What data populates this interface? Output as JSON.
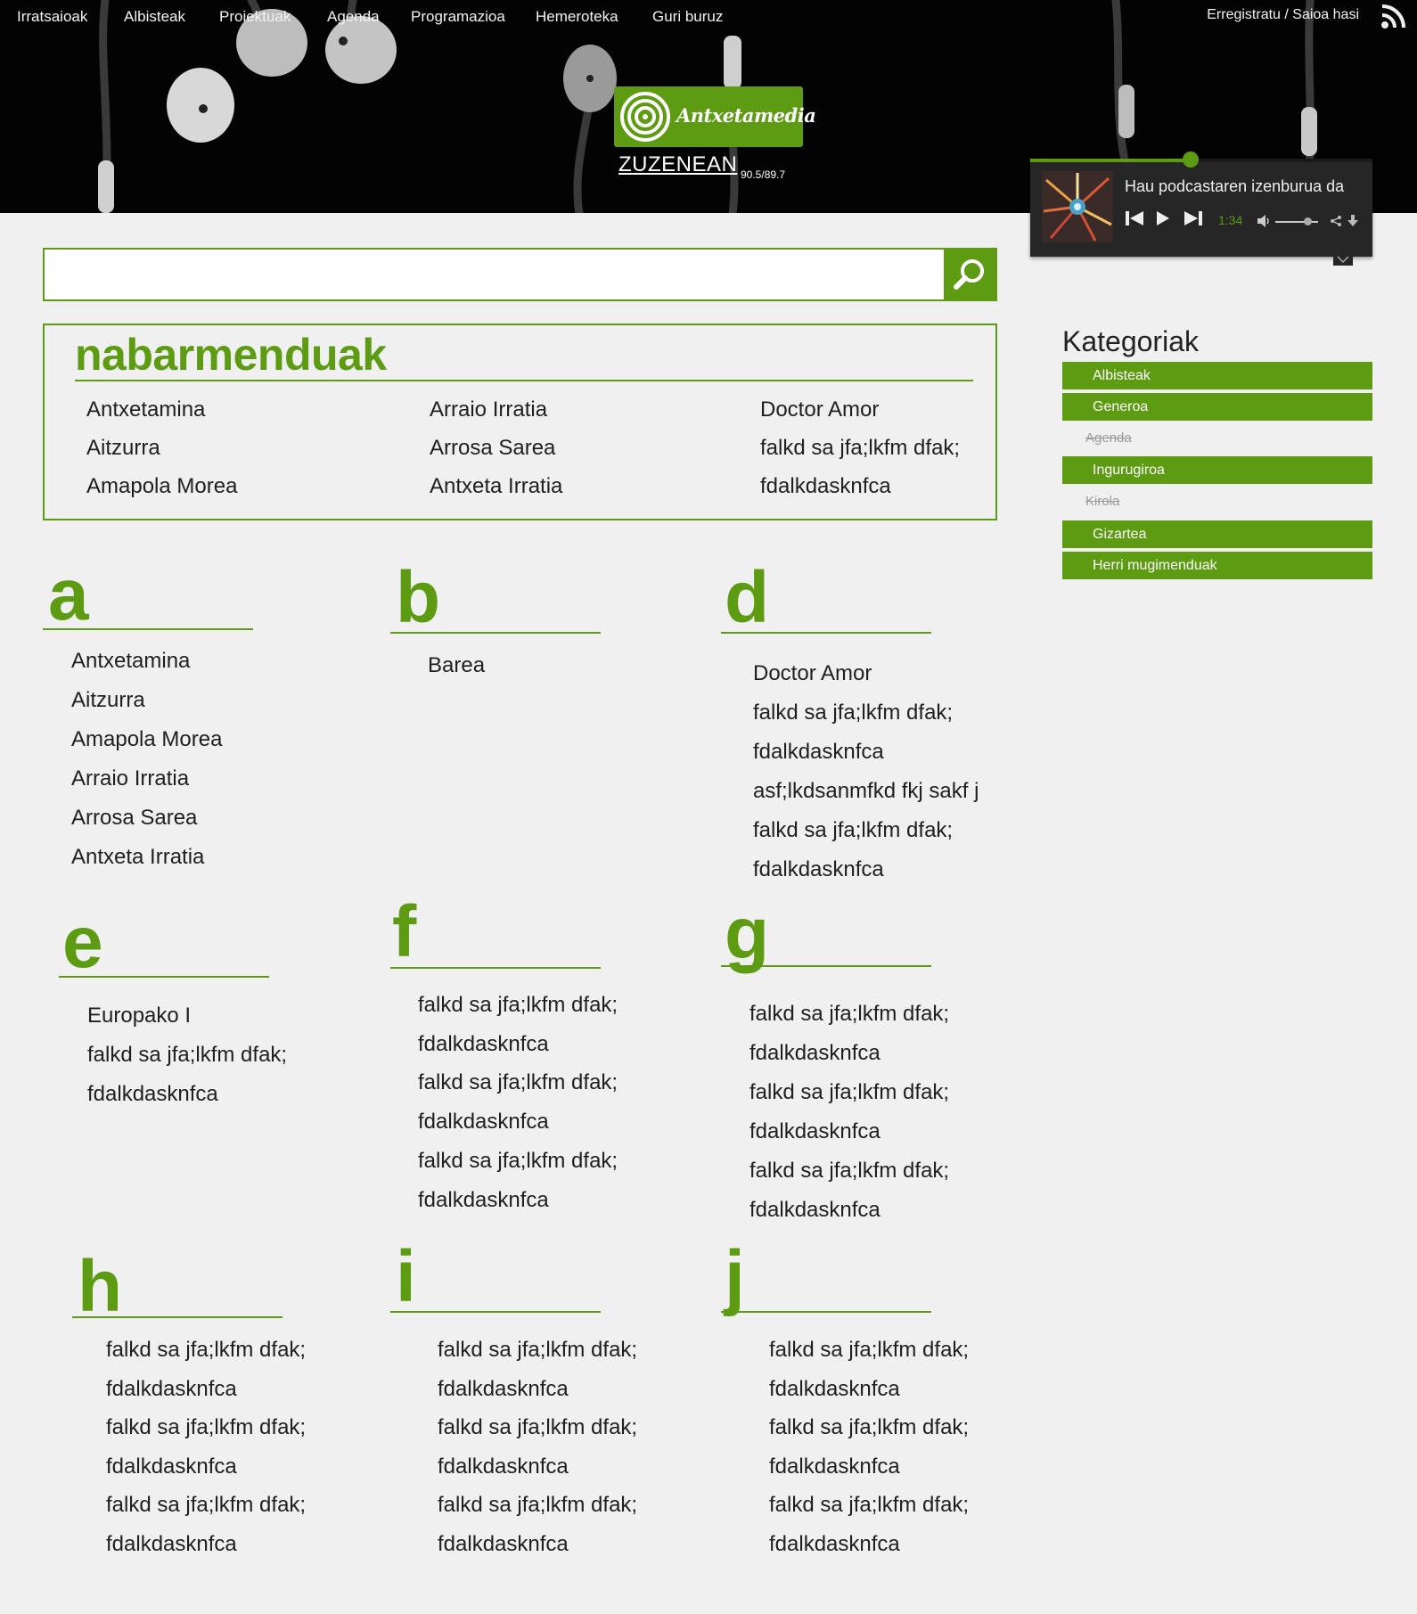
{
  "nav": {
    "items": [
      "Irratsaioak",
      "Albisteak",
      "Proiektuak",
      "Agenda",
      "Programazioa",
      "Hemeroteka",
      "Guri buruz"
    ],
    "login": "Erregistratu / Saioa hasi"
  },
  "logo": {
    "name": "Antxetamedia",
    "live_label": "ZUZENEAN",
    "frequency": "90.5/89.7"
  },
  "player": {
    "title": "Hau podcastaren izenburua da",
    "time": "1:34",
    "progress": 0.47,
    "volume": 0.75
  },
  "search": {
    "value": "",
    "placeholder": ""
  },
  "featured": {
    "title": "nabarmenduak",
    "columns": [
      [
        "Antxetamina",
        "Aitzurra",
        "Amapola Morea"
      ],
      [
        "Arraio Irratia",
        "Arrosa Sarea",
        "Antxeta Irratia"
      ],
      [
        "Doctor Amor",
        "falkd sa jfa;lkfm   dfak;",
        "fdalkdasknfca"
      ]
    ]
  },
  "groups": [
    {
      "letter": "a",
      "items": [
        "Antxetamina",
        "Aitzurra",
        "Amapola Morea",
        "Arraio Irratia",
        "Arrosa Sarea",
        "Antxeta Irratia"
      ]
    },
    {
      "letter": "b",
      "items": [
        "Barea"
      ]
    },
    {
      "letter": "d",
      "items": [
        "Doctor Amor",
        "falkd sa jfa;lkfm   dfak;",
        "fdalkdasknfca",
        "asf;lkdsanmfkd fkj sakf   j",
        "falkd sa jfa;lkfm   dfak;",
        "fdalkdasknfca"
      ]
    },
    {
      "letter": "e",
      "items": [
        "Europako I",
        "falkd sa jfa;lkfm   dfak;",
        "fdalkdasknfca"
      ]
    },
    {
      "letter": "f",
      "items": [
        "falkd sa jfa;lkfm   dfak;",
        "fdalkdasknfca",
        "falkd sa jfa;lkfm   dfak;",
        "fdalkdasknfca",
        "falkd sa jfa;lkfm   dfak;",
        "fdalkdasknfca"
      ]
    },
    {
      "letter": "g",
      "items": [
        "falkd sa jfa;lkfm   dfak;",
        "fdalkdasknfca",
        "falkd sa jfa;lkfm   dfak;",
        "fdalkdasknfca",
        "falkd sa jfa;lkfm   dfak;",
        "fdalkdasknfca"
      ]
    },
    {
      "letter": "h",
      "items": [
        "falkd sa jfa;lkfm   dfak;",
        "fdalkdasknfca",
        "falkd sa jfa;lkfm   dfak;",
        "fdalkdasknfca",
        "falkd sa jfa;lkfm   dfak;",
        "fdalkdasknfca"
      ]
    },
    {
      "letter": "i",
      "items": [
        "falkd sa jfa;lkfm   dfak;",
        "fdalkdasknfca",
        "falkd sa jfa;lkfm   dfak;",
        "fdalkdasknfca",
        "falkd sa jfa;lkfm   dfak;",
        "fdalkdasknfca"
      ]
    },
    {
      "letter": "j",
      "items": [
        "falkd sa jfa;lkfm   dfak;",
        "fdalkdasknfca",
        "falkd sa jfa;lkfm   dfak;",
        "fdalkdasknfca",
        "falkd sa jfa;lkfm   dfak;",
        "fdalkdasknfca"
      ]
    }
  ],
  "sidebar": {
    "title": "Kategoriak",
    "categories": [
      {
        "label": "Albisteak",
        "enabled": true
      },
      {
        "label": "Generoa",
        "enabled": true
      },
      {
        "label": "Agenda",
        "enabled": false
      },
      {
        "label": "Ingurugiroa",
        "enabled": true
      },
      {
        "label": "Kirola",
        "enabled": false
      },
      {
        "label": "Gizartea",
        "enabled": true
      },
      {
        "label": "Herri mugimenduak",
        "enabled": true
      }
    ]
  },
  "colors": {
    "accent": "#5c9b12",
    "header_bg": "#030303",
    "page_bg": "#f0f0f0",
    "player_bg": "#262626"
  }
}
